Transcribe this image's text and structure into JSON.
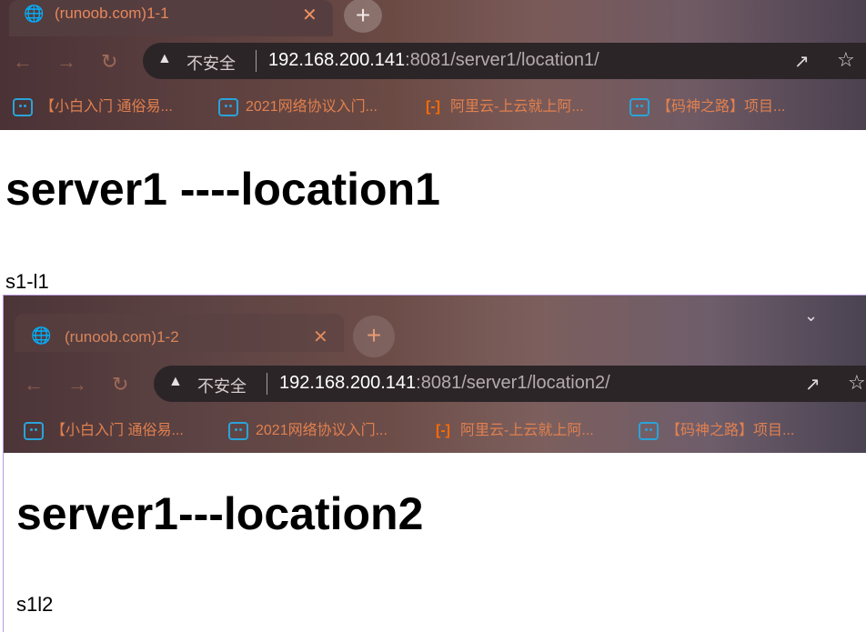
{
  "window1": {
    "tab": {
      "title": "(runoob.com)1-1",
      "favicon": "globe-icon",
      "close": "✕",
      "new_tab": "+"
    },
    "omnibox": {
      "security": "不安全",
      "host": "192.168.200.141",
      "rest": ":8081/server1/location1/"
    },
    "bookmarks": [
      "【小白入门 通俗易...",
      "2021网络协议入门...",
      "阿里云-上云就上阿...",
      "【码神之路】项目..."
    ],
    "content": {
      "heading": "server1 ----location1",
      "paragraph": "s1-l1"
    }
  },
  "window2": {
    "tab": {
      "title": "(runoob.com)1-2",
      "favicon": "globe-icon",
      "close": "✕",
      "new_tab": "+"
    },
    "omnibox": {
      "security": "不安全",
      "host": "192.168.200.141",
      "rest": ":8081/server1/location2/"
    },
    "bookmarks": [
      "【小白入门 通俗易...",
      "2021网络协议入门...",
      "阿里云-上云就上阿...",
      "【码神之路】项目..."
    ],
    "content": {
      "heading": "server1---location2",
      "paragraph": "s1l2"
    }
  },
  "colors": {
    "tab_text": "#e8875a",
    "bookmark_text": "#e1804e",
    "bili_icon": "#2aa3d9",
    "aliyun_icon": "#ff6a00"
  }
}
